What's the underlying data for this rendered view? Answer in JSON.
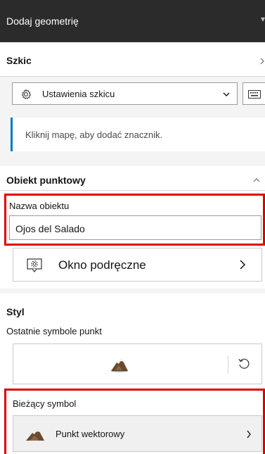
{
  "header": {
    "title": "Dodaj geometrię"
  },
  "sketch": {
    "title": "Szkic",
    "settings_label": "Ustawienia szkicu"
  },
  "notice": {
    "text": "Kliknij mapę, aby dodać znacznik."
  },
  "point_feature": {
    "title": "Obiekt punktowy",
    "name_label": "Nazwa obiektu",
    "name_value": "Ojos del Salado",
    "popup_label": "Okno podręczne"
  },
  "style": {
    "title": "Styl",
    "recent_label": "Ostatnie symbole punkt",
    "current_label": "Bieżący symbol",
    "current_symbol": "Punkt wektorowy"
  },
  "colors": {
    "accent": "#007ac2",
    "highlight": "#e00000",
    "header_bg": "#2b2b2b"
  },
  "icons": [
    "gear-icon",
    "chevron-down-icon",
    "keyboard-icon",
    "chevron-up-icon",
    "popup-gear-icon",
    "chevron-right-icon",
    "mountain-symbol-icon",
    "reset-icon"
  ]
}
